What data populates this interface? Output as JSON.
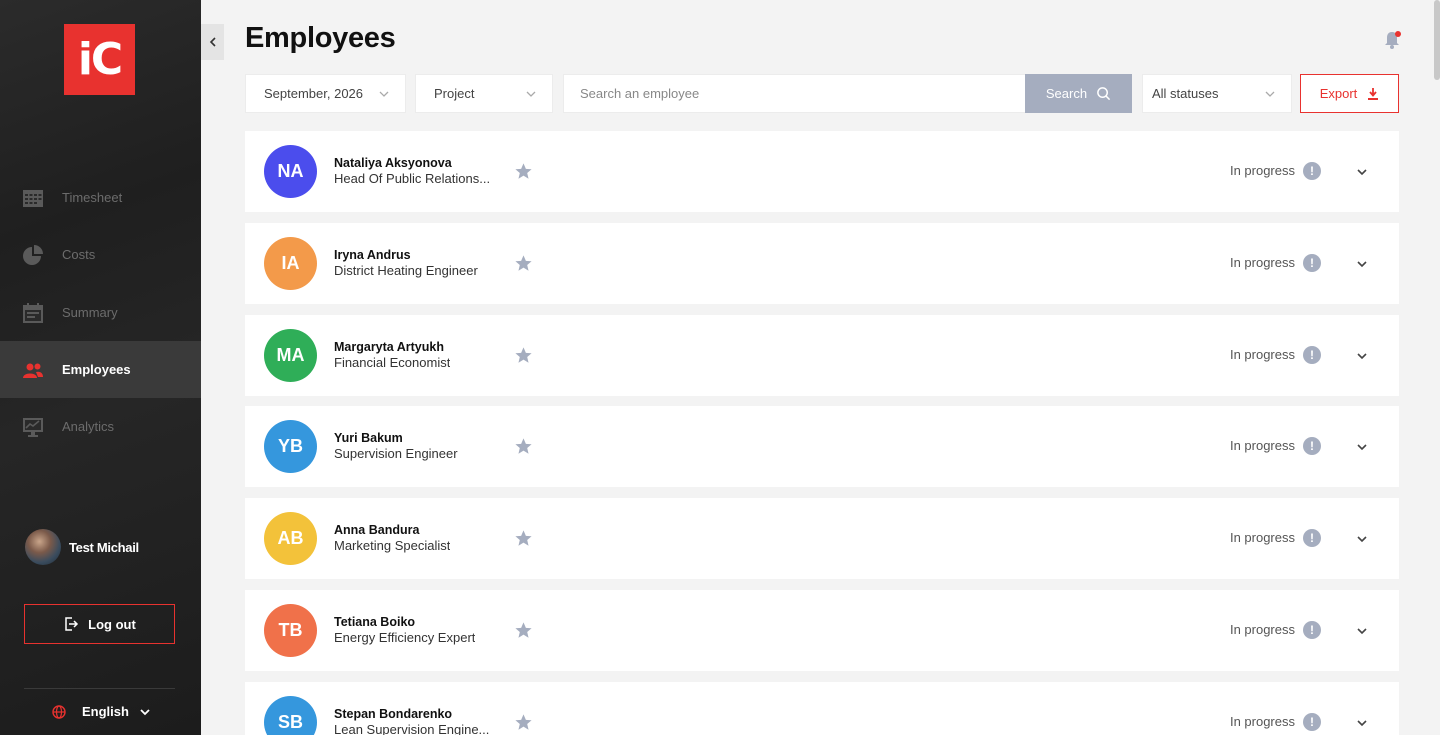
{
  "app": {
    "logo_text": "iC",
    "page_title": "Employees"
  },
  "sidebar": {
    "items": [
      {
        "label": "Timesheet",
        "icon": "timesheet-icon",
        "active": false
      },
      {
        "label": "Costs",
        "icon": "pie-chart-icon",
        "active": false
      },
      {
        "label": "Summary",
        "icon": "calendar-icon",
        "active": false
      },
      {
        "label": "Employees",
        "icon": "users-icon",
        "active": true
      },
      {
        "label": "Analytics",
        "icon": "monitor-chart-icon",
        "active": false
      }
    ],
    "user_name": "Test Michail",
    "logout_label": "Log out",
    "language": "English"
  },
  "toolbar": {
    "month": "September, 2026",
    "project": "Project",
    "search_placeholder": "Search an employee",
    "search_label": "Search",
    "status": "All statuses",
    "export_label": "Export"
  },
  "employees": [
    {
      "initials": "NA",
      "name": "Nataliya Aksyonova",
      "role": "Head Of Public Relations...",
      "status": "In progress",
      "color": "#4b4ded"
    },
    {
      "initials": "IA",
      "name": "Iryna Andrus",
      "role": "District Heating Engineer",
      "status": "In progress",
      "color": "#f39a4a"
    },
    {
      "initials": "MA",
      "name": "Margaryta Artyukh",
      "role": "Financial Economist",
      "status": "In progress",
      "color": "#2fae58"
    },
    {
      "initials": "YB",
      "name": "Yuri Bakum",
      "role": "Supervision Engineer",
      "status": "In progress",
      "color": "#3597dd"
    },
    {
      "initials": "AB",
      "name": "Anna Bandura",
      "role": "Marketing Specialist",
      "status": "In progress",
      "color": "#f3c23a"
    },
    {
      "initials": "TB",
      "name": "Tetiana Boiko",
      "role": "Energy Efficiency Expert",
      "status": "In progress",
      "color": "#f0714a"
    },
    {
      "initials": "SB",
      "name": "Stepan Bondarenko",
      "role": "Lean Supervision Engine...",
      "status": "In progress",
      "color": "#3597dd"
    }
  ],
  "colors": {
    "accent": "#e8322f",
    "sidebar_bg": "#222222",
    "muted_button": "#a5adbf"
  }
}
